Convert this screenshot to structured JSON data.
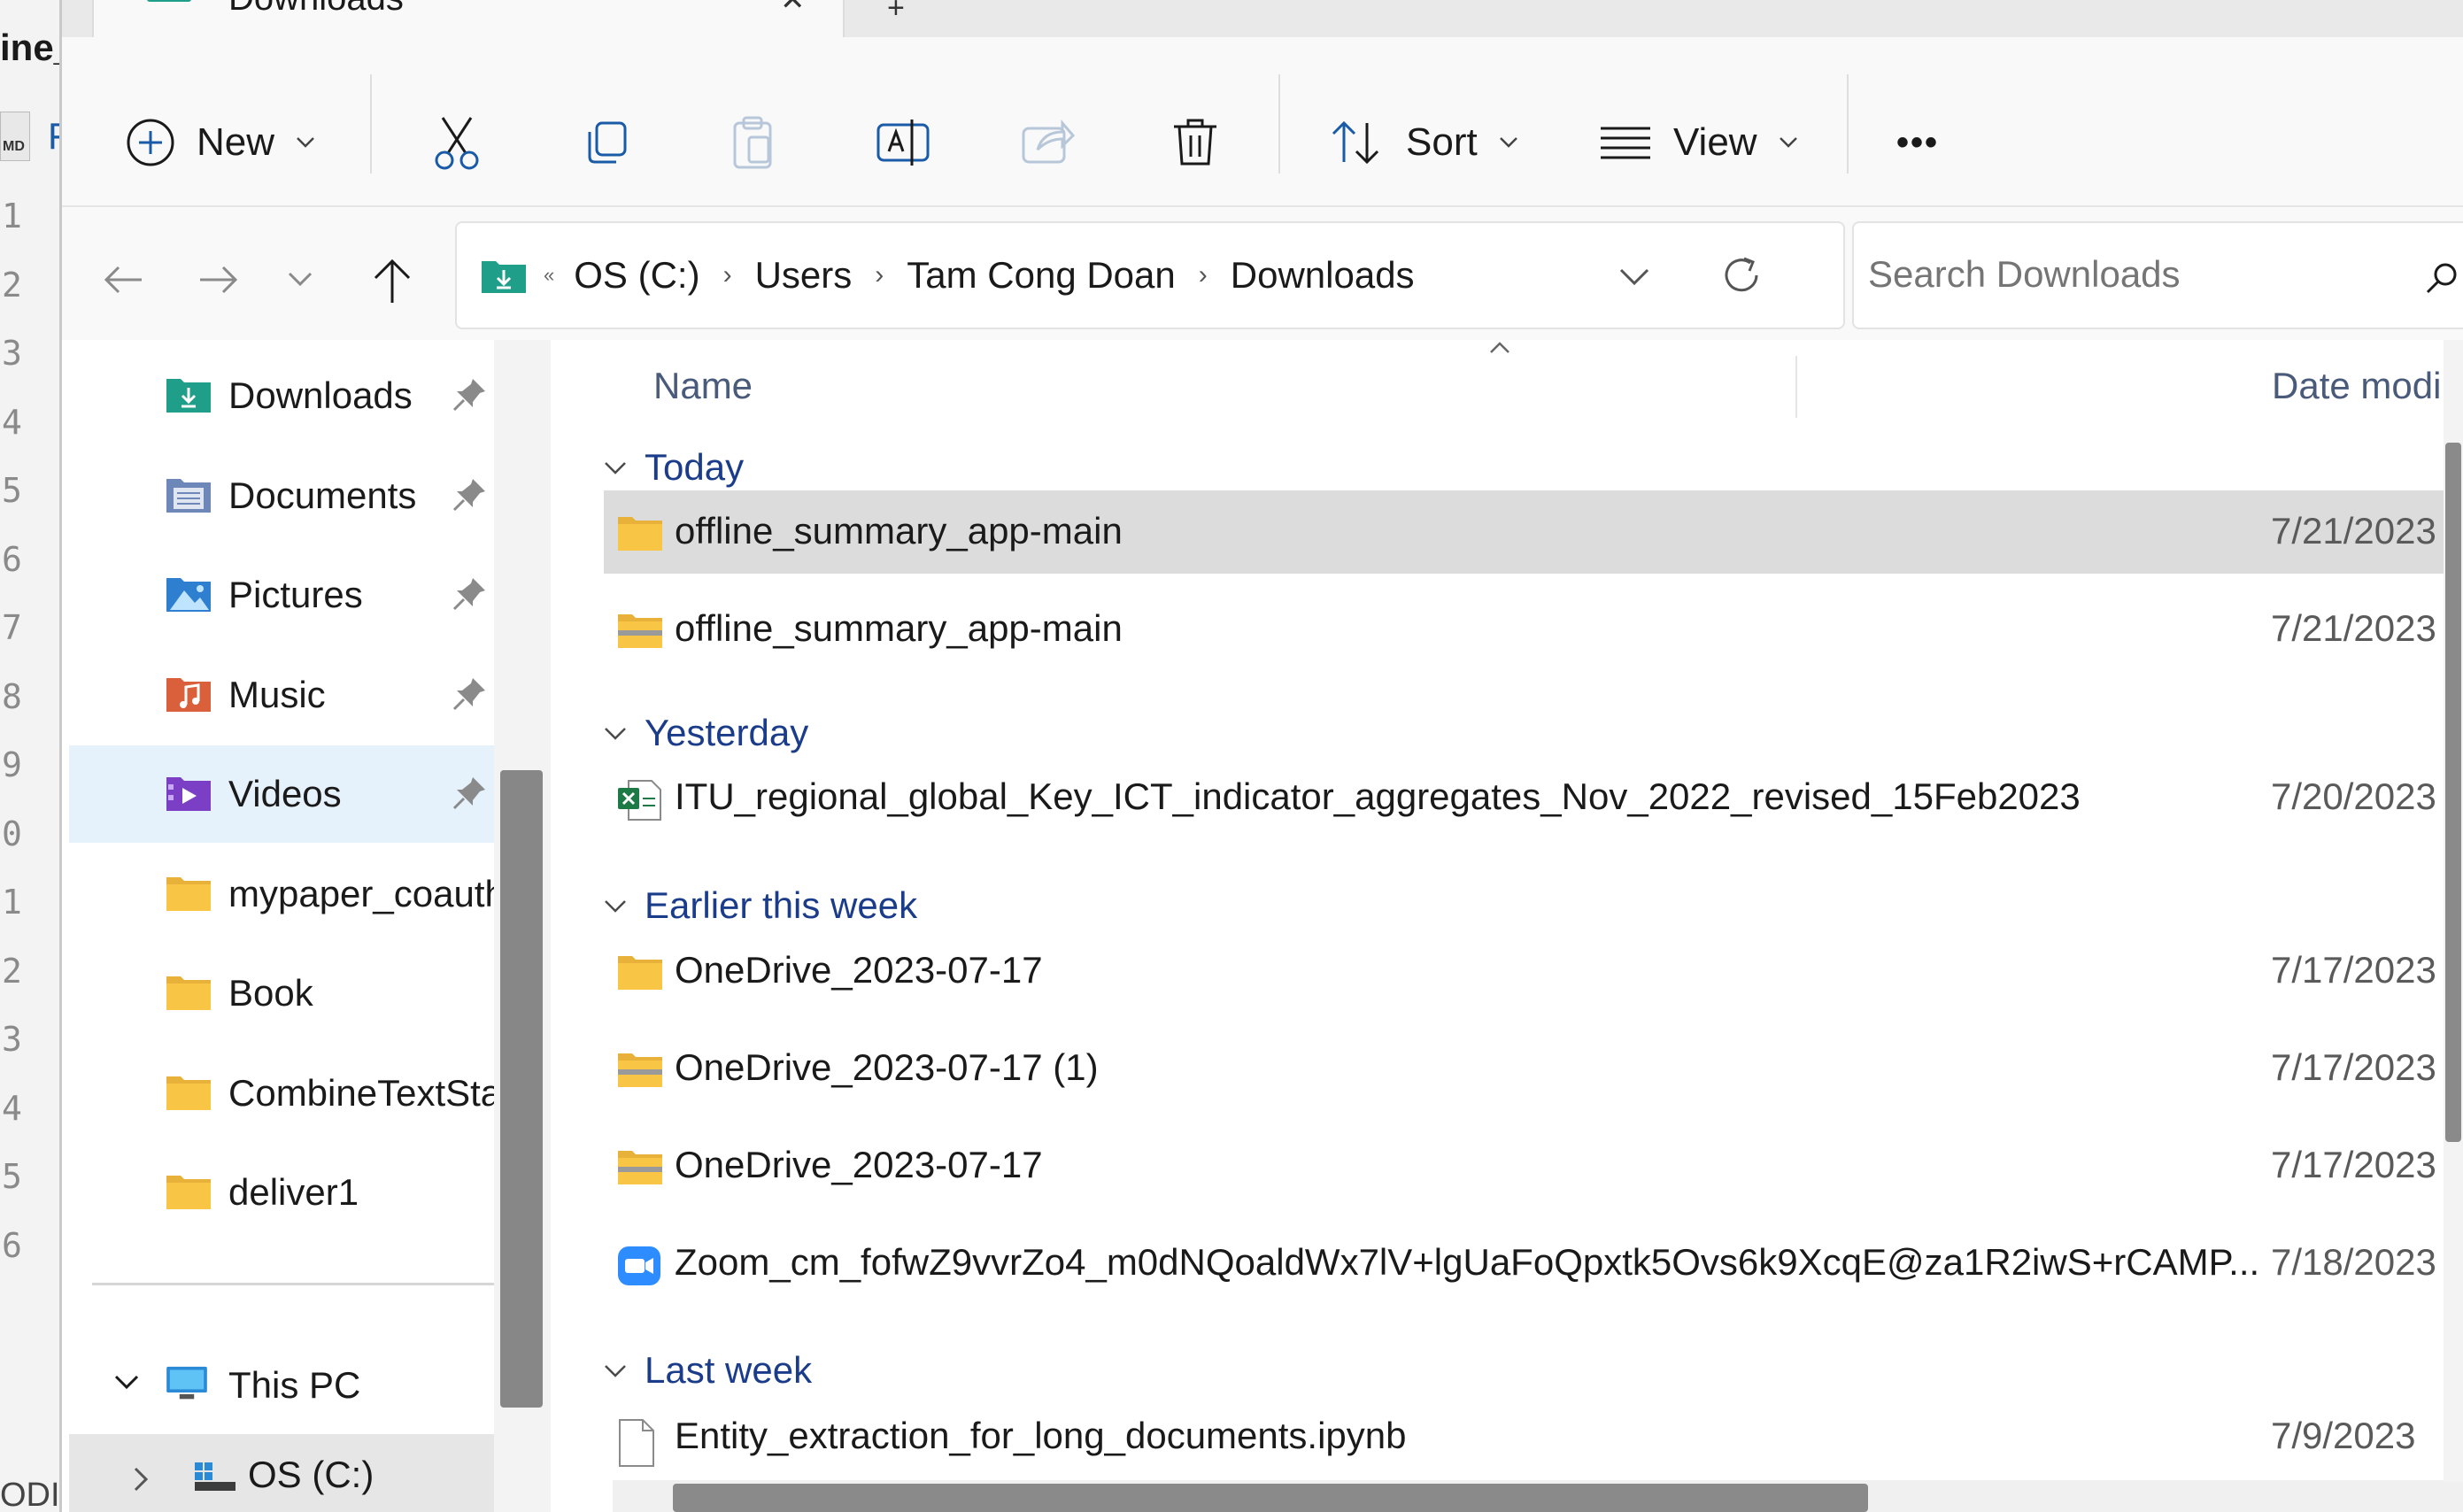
{
  "background_editor": {
    "title_fragment": "ine_",
    "badge": "MD",
    "letter": "F",
    "line_numbers": [
      "1",
      "2",
      "3",
      "4",
      "5",
      "6",
      "7",
      "8",
      "9",
      "0",
      "1",
      "2",
      "3",
      "4",
      "5",
      "6"
    ],
    "footer_fragment": "ODI"
  },
  "window": {
    "tab_title": "Downloads"
  },
  "toolbar": {
    "new_label": "New",
    "sort_label": "Sort",
    "view_label": "View",
    "more_label": "•••"
  },
  "address": {
    "overflow": "«",
    "crumbs": [
      "OS (C:)",
      "Users",
      "Tam Cong Doan",
      "Downloads"
    ],
    "search_placeholder": "Search Downloads"
  },
  "sidebar": {
    "items": [
      {
        "label": "Downloads",
        "icon": "downloads-folder-icon",
        "pinned": true
      },
      {
        "label": "Documents",
        "icon": "documents-folder-icon",
        "pinned": true
      },
      {
        "label": "Pictures",
        "icon": "pictures-folder-icon",
        "pinned": true
      },
      {
        "label": "Music",
        "icon": "music-folder-icon",
        "pinned": true
      },
      {
        "label": "Videos",
        "icon": "videos-folder-icon",
        "pinned": true,
        "selected": true
      },
      {
        "label": "mypaper_coauth",
        "icon": "folder-icon",
        "pinned": false
      },
      {
        "label": "Book",
        "icon": "folder-icon",
        "pinned": false
      },
      {
        "label": "CombineTextStar",
        "icon": "folder-icon",
        "pinned": false
      },
      {
        "label": "deliver1",
        "icon": "folder-icon",
        "pinned": false
      }
    ],
    "this_pc": "This PC",
    "os_drive": "OS (C:)"
  },
  "columns": {
    "name": "Name",
    "date": "Date modi"
  },
  "groups": [
    {
      "label": "Today",
      "files": [
        {
          "name": "offline_summary_app-main",
          "date": "7/21/2023",
          "icon": "folder-icon",
          "selected": true
        },
        {
          "name": "offline_summary_app-main",
          "date": "7/21/2023",
          "icon": "zip-folder-icon"
        }
      ]
    },
    {
      "label": "Yesterday",
      "files": [
        {
          "name": "ITU_regional_global_Key_ICT_indicator_aggregates_Nov_2022_revised_15Feb2023",
          "date": "7/20/2023",
          "icon": "excel-file-icon"
        }
      ]
    },
    {
      "label": "Earlier this week",
      "files": [
        {
          "name": "OneDrive_2023-07-17",
          "date": "7/17/2023",
          "icon": "folder-icon"
        },
        {
          "name": "OneDrive_2023-07-17 (1)",
          "date": "7/17/2023",
          "icon": "zip-folder-icon"
        },
        {
          "name": "OneDrive_2023-07-17",
          "date": "7/17/2023",
          "icon": "zip-folder-icon"
        },
        {
          "name": "Zoom_cm_fofwZ9vvrZo4_m0dNQoaldWx7lV+lgUaFoQpxtk5Ovs6k9XcqE@za1R2iwS+rCAMP...",
          "date": "7/18/2023",
          "icon": "zoom-file-icon"
        }
      ]
    },
    {
      "label": "Last week",
      "files": [
        {
          "name": "Entity_extraction_for_long_documents.ipynb",
          "date": "7/9/2023",
          "icon": "document-file-icon"
        }
      ]
    }
  ],
  "colors": {
    "accent": "#1a3c8a",
    "selection_row": "#dcdcdc",
    "selection_nav": "#e5f1fb",
    "folder": "#f8c644"
  }
}
